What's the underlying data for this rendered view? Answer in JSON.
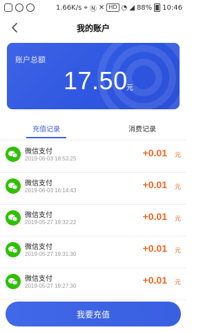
{
  "status_bar": {
    "speed": "1.66K/s",
    "network_badge": "HD",
    "battery": "88%",
    "time": "10:46"
  },
  "header": {
    "title": "我的账户"
  },
  "balance": {
    "label": "账户总额",
    "amount": "17.50",
    "unit": "元"
  },
  "tabs": [
    {
      "label": "充值记录",
      "active": true
    },
    {
      "label": "消费记录",
      "active": false
    }
  ],
  "records": [
    {
      "name": "微信支付",
      "time": "2019-06-03 18:53:25",
      "amount": "+0.01",
      "unit": "元"
    },
    {
      "name": "微信支付",
      "time": "2019-06-03 16:14:43",
      "amount": "+0.01",
      "unit": "元"
    },
    {
      "name": "微信支付",
      "time": "2019-05-27 19:32:22",
      "amount": "+0.01",
      "unit": "元"
    },
    {
      "name": "微信支付",
      "time": "2019-05-27 19:31:30",
      "amount": "+0.01",
      "unit": "元"
    },
    {
      "name": "微信支付",
      "time": "2019-05-27 19:27:30",
      "amount": "+0.01",
      "unit": "元"
    }
  ],
  "recharge_button": {
    "label": "我要充值"
  },
  "colors": {
    "accent": "#3b5fe0",
    "amount": "#f0641e",
    "wechat": "#2dc100"
  }
}
